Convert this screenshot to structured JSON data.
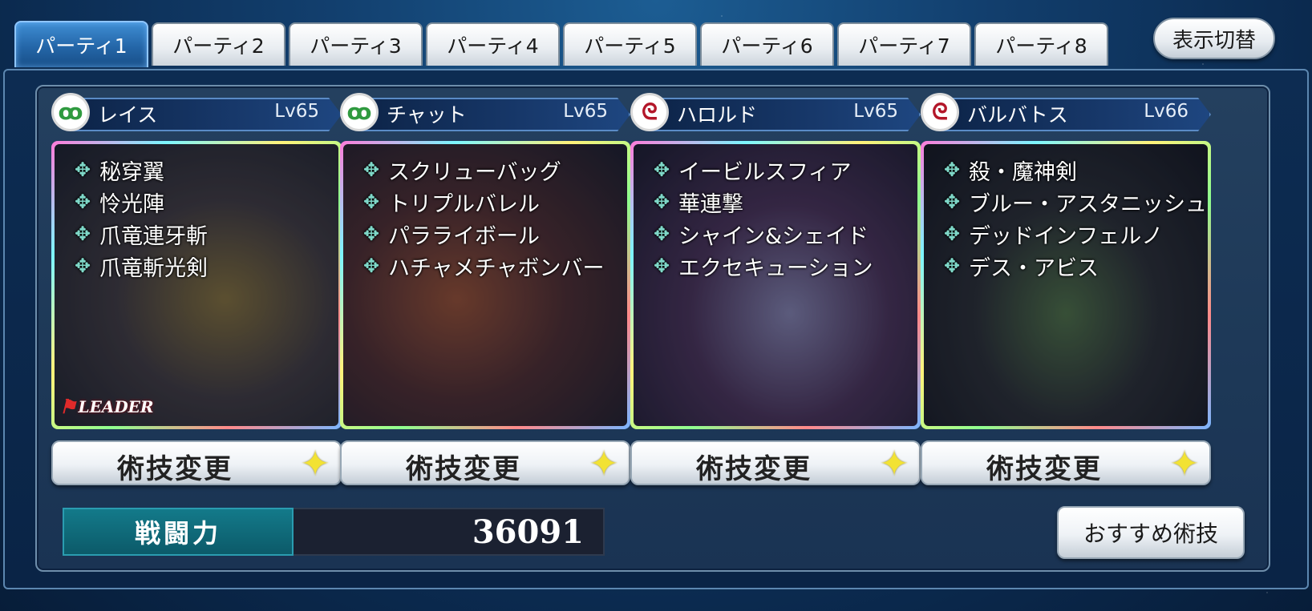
{
  "tabs": [
    "パーティ1",
    "パーティ2",
    "パーティ3",
    "パーティ4",
    "パーティ5",
    "パーティ6",
    "パーティ7",
    "パーティ8"
  ],
  "active_tab": 0,
  "toggle_label": "表示切替",
  "characters": [
    {
      "name": "レイス",
      "level": "Lv65",
      "element": "wind-emblem",
      "skills": [
        "秘穿翼",
        "怜光陣",
        "爪竜連牙斬",
        "爪竜斬光剣"
      ]
    },
    {
      "name": "チャット",
      "level": "Lv65",
      "element": "wind-emblem",
      "skills": [
        "スクリューバッグ",
        "トリプルバレル",
        "パラライボール",
        "ハチャメチャボンバー"
      ]
    },
    {
      "name": "ハロルド",
      "level": "Lv65",
      "element": "fire-emblem",
      "skills": [
        "イービルスフィア",
        "華連撃",
        "シャイン&シェイド",
        "エクセキューション"
      ]
    },
    {
      "name": "バルバトス",
      "level": "Lv66",
      "element": "fire-emblem",
      "skills": [
        "殺・魔神剣",
        "ブルー・アスタニッシュ",
        "デッドインフェルノ",
        "デス・アビス"
      ]
    }
  ],
  "leader_label": "LEADER",
  "skill_change_label": "術技変更",
  "power": {
    "label": "戦闘力",
    "value": "36091"
  },
  "recommend_label": "おすすめ術技",
  "colors": {
    "accent_tab": "#2466a8",
    "power_label_bg": "#137a8a",
    "skill_star": "#f2e233"
  }
}
